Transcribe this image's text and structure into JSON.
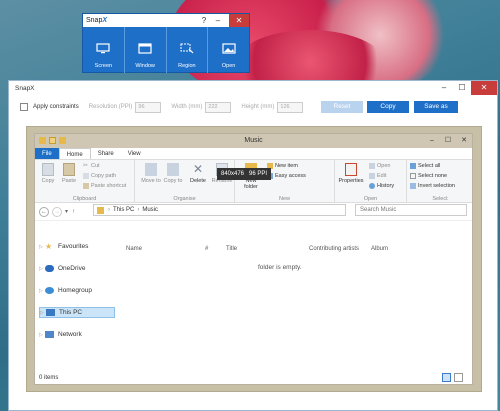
{
  "snapx": {
    "title_prefix": "Snap",
    "title_accent": "X",
    "help": "?",
    "minimize": "–",
    "close": "✕",
    "modes": [
      {
        "label": "Screen",
        "icon": "monitor-icon"
      },
      {
        "label": "Window",
        "icon": "window-icon"
      },
      {
        "label": "Region",
        "icon": "region-icon"
      },
      {
        "label": "Open",
        "icon": "image-icon"
      }
    ]
  },
  "main": {
    "title": "SnapX",
    "minimize": "–",
    "maximize": "☐",
    "close": "✕",
    "apply_constraints": "Apply constraints",
    "resolution_label": "Resolution (PPI)",
    "resolution_value": "96",
    "width_label": "Width (mm)",
    "width_value": "222",
    "height_label": "Height (mm)",
    "height_value": "126",
    "reset": "Reset",
    "copy": "Copy",
    "save_as": "Save as",
    "accent": "#1e6fc8"
  },
  "tooltip": {
    "size": "840x476",
    "ppi": "96 PPI"
  },
  "explorer": {
    "title": "Music",
    "tabs": [
      "File",
      "Home",
      "Share",
      "View"
    ],
    "ribbon": {
      "clipboard": {
        "label": "Clipboard",
        "copy": "Copy",
        "paste": "Paste",
        "cut": "Cut",
        "copy_path": "Copy path",
        "paste_shortcut": "Paste shortcut"
      },
      "organise": {
        "label": "Organise",
        "move_to": "Move to",
        "copy_to": "Copy to",
        "delete": "Delete",
        "rename": "Rename"
      },
      "new": {
        "label": "New",
        "new_folder": "New folder",
        "new_item": "New item",
        "easy_access": "Easy access"
      },
      "open": {
        "label": "Open",
        "properties": "Properties",
        "open": "Open",
        "edit": "Edit",
        "history": "History"
      },
      "select": {
        "label": "Select",
        "select_all": "Select all",
        "select_none": "Select none",
        "invert": "Invert selection"
      }
    },
    "address": {
      "this_pc": "This PC",
      "music": "Music",
      "search_placeholder": "Search Music"
    },
    "nav": [
      "Favourites",
      "OneDrive",
      "Homegroup",
      "This PC",
      "Network"
    ],
    "columns": [
      "Name",
      "#",
      "Title",
      "Contributing artists",
      "Album"
    ],
    "empty_text": "folder is empty.",
    "status": "0 items"
  }
}
